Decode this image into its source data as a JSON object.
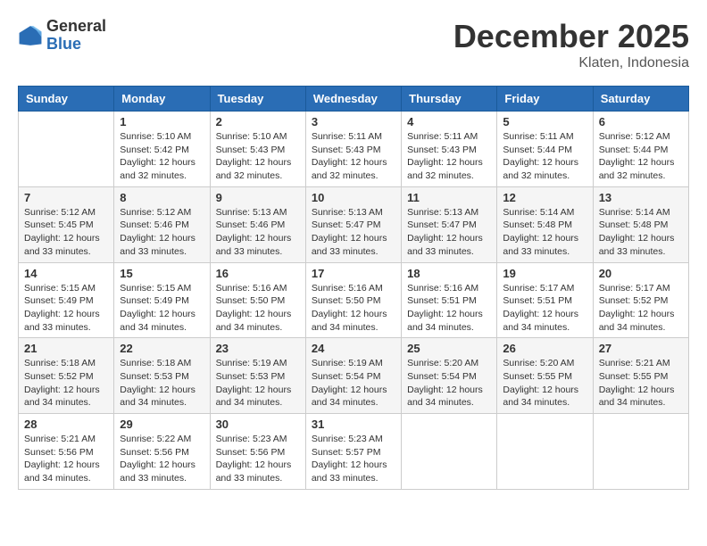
{
  "header": {
    "logo_general": "General",
    "logo_blue": "Blue",
    "month_title": "December 2025",
    "location": "Klaten, Indonesia"
  },
  "weekdays": [
    "Sunday",
    "Monday",
    "Tuesday",
    "Wednesday",
    "Thursday",
    "Friday",
    "Saturday"
  ],
  "weeks": [
    [
      {
        "day": "",
        "info": ""
      },
      {
        "day": "1",
        "info": "Sunrise: 5:10 AM\nSunset: 5:42 PM\nDaylight: 12 hours\nand 32 minutes."
      },
      {
        "day": "2",
        "info": "Sunrise: 5:10 AM\nSunset: 5:43 PM\nDaylight: 12 hours\nand 32 minutes."
      },
      {
        "day": "3",
        "info": "Sunrise: 5:11 AM\nSunset: 5:43 PM\nDaylight: 12 hours\nand 32 minutes."
      },
      {
        "day": "4",
        "info": "Sunrise: 5:11 AM\nSunset: 5:43 PM\nDaylight: 12 hours\nand 32 minutes."
      },
      {
        "day": "5",
        "info": "Sunrise: 5:11 AM\nSunset: 5:44 PM\nDaylight: 12 hours\nand 32 minutes."
      },
      {
        "day": "6",
        "info": "Sunrise: 5:12 AM\nSunset: 5:44 PM\nDaylight: 12 hours\nand 32 minutes."
      }
    ],
    [
      {
        "day": "7",
        "info": "Sunrise: 5:12 AM\nSunset: 5:45 PM\nDaylight: 12 hours\nand 33 minutes."
      },
      {
        "day": "8",
        "info": "Sunrise: 5:12 AM\nSunset: 5:46 PM\nDaylight: 12 hours\nand 33 minutes."
      },
      {
        "day": "9",
        "info": "Sunrise: 5:13 AM\nSunset: 5:46 PM\nDaylight: 12 hours\nand 33 minutes."
      },
      {
        "day": "10",
        "info": "Sunrise: 5:13 AM\nSunset: 5:47 PM\nDaylight: 12 hours\nand 33 minutes."
      },
      {
        "day": "11",
        "info": "Sunrise: 5:13 AM\nSunset: 5:47 PM\nDaylight: 12 hours\nand 33 minutes."
      },
      {
        "day": "12",
        "info": "Sunrise: 5:14 AM\nSunset: 5:48 PM\nDaylight: 12 hours\nand 33 minutes."
      },
      {
        "day": "13",
        "info": "Sunrise: 5:14 AM\nSunset: 5:48 PM\nDaylight: 12 hours\nand 33 minutes."
      }
    ],
    [
      {
        "day": "14",
        "info": "Sunrise: 5:15 AM\nSunset: 5:49 PM\nDaylight: 12 hours\nand 33 minutes."
      },
      {
        "day": "15",
        "info": "Sunrise: 5:15 AM\nSunset: 5:49 PM\nDaylight: 12 hours\nand 34 minutes."
      },
      {
        "day": "16",
        "info": "Sunrise: 5:16 AM\nSunset: 5:50 PM\nDaylight: 12 hours\nand 34 minutes."
      },
      {
        "day": "17",
        "info": "Sunrise: 5:16 AM\nSunset: 5:50 PM\nDaylight: 12 hours\nand 34 minutes."
      },
      {
        "day": "18",
        "info": "Sunrise: 5:16 AM\nSunset: 5:51 PM\nDaylight: 12 hours\nand 34 minutes."
      },
      {
        "day": "19",
        "info": "Sunrise: 5:17 AM\nSunset: 5:51 PM\nDaylight: 12 hours\nand 34 minutes."
      },
      {
        "day": "20",
        "info": "Sunrise: 5:17 AM\nSunset: 5:52 PM\nDaylight: 12 hours\nand 34 minutes."
      }
    ],
    [
      {
        "day": "21",
        "info": "Sunrise: 5:18 AM\nSunset: 5:52 PM\nDaylight: 12 hours\nand 34 minutes."
      },
      {
        "day": "22",
        "info": "Sunrise: 5:18 AM\nSunset: 5:53 PM\nDaylight: 12 hours\nand 34 minutes."
      },
      {
        "day": "23",
        "info": "Sunrise: 5:19 AM\nSunset: 5:53 PM\nDaylight: 12 hours\nand 34 minutes."
      },
      {
        "day": "24",
        "info": "Sunrise: 5:19 AM\nSunset: 5:54 PM\nDaylight: 12 hours\nand 34 minutes."
      },
      {
        "day": "25",
        "info": "Sunrise: 5:20 AM\nSunset: 5:54 PM\nDaylight: 12 hours\nand 34 minutes."
      },
      {
        "day": "26",
        "info": "Sunrise: 5:20 AM\nSunset: 5:55 PM\nDaylight: 12 hours\nand 34 minutes."
      },
      {
        "day": "27",
        "info": "Sunrise: 5:21 AM\nSunset: 5:55 PM\nDaylight: 12 hours\nand 34 minutes."
      }
    ],
    [
      {
        "day": "28",
        "info": "Sunrise: 5:21 AM\nSunset: 5:56 PM\nDaylight: 12 hours\nand 34 minutes."
      },
      {
        "day": "29",
        "info": "Sunrise: 5:22 AM\nSunset: 5:56 PM\nDaylight: 12 hours\nand 33 minutes."
      },
      {
        "day": "30",
        "info": "Sunrise: 5:23 AM\nSunset: 5:56 PM\nDaylight: 12 hours\nand 33 minutes."
      },
      {
        "day": "31",
        "info": "Sunrise: 5:23 AM\nSunset: 5:57 PM\nDaylight: 12 hours\nand 33 minutes."
      },
      {
        "day": "",
        "info": ""
      },
      {
        "day": "",
        "info": ""
      },
      {
        "day": "",
        "info": ""
      }
    ]
  ]
}
